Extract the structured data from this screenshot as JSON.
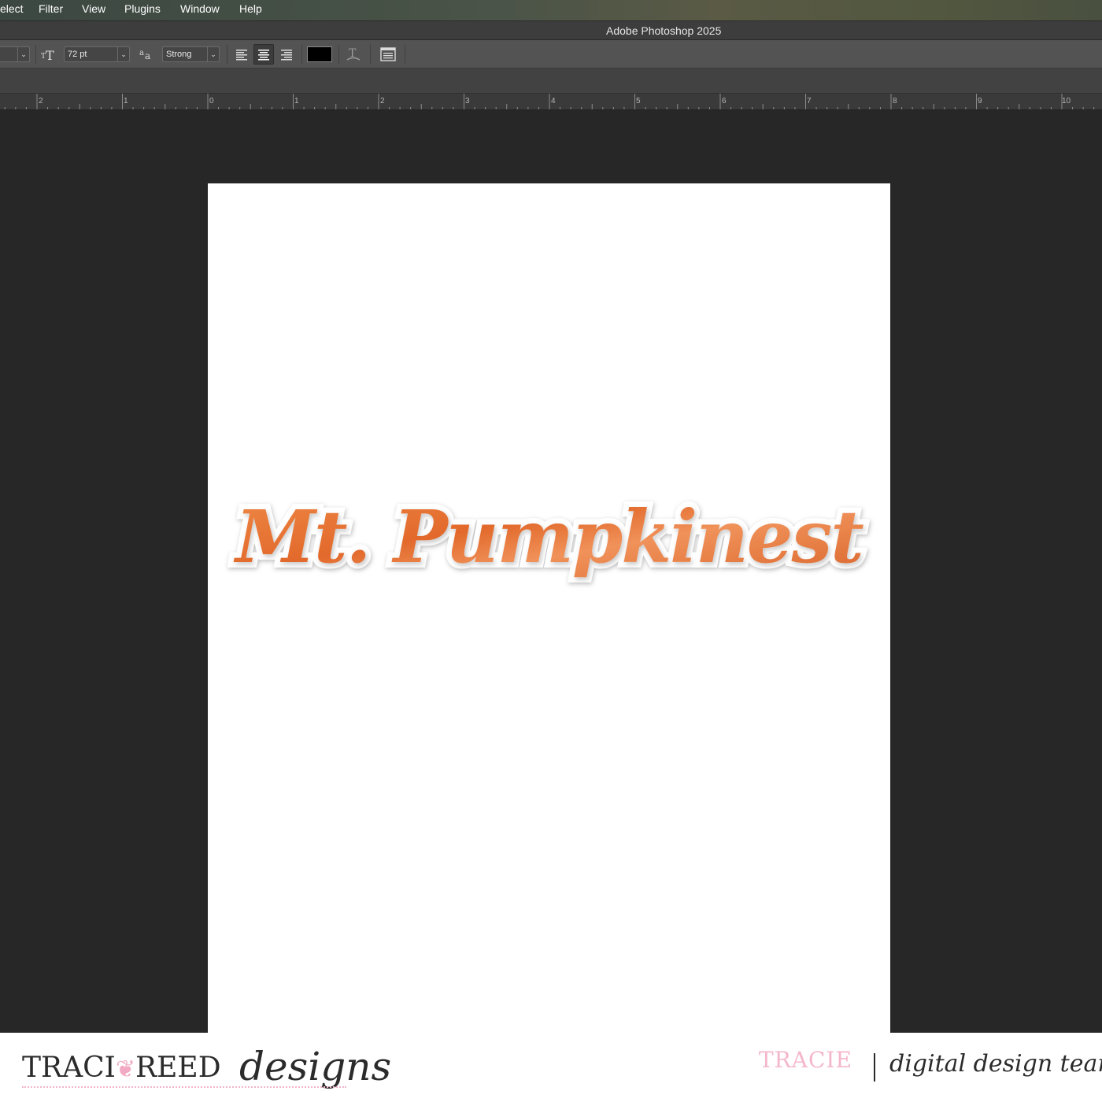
{
  "menu": {
    "items": [
      "elect",
      "Filter",
      "View",
      "Plugins",
      "Window",
      "Help"
    ]
  },
  "titlebar": {
    "title": "Adobe Photoshop 2025"
  },
  "options": {
    "font_size": "72 pt",
    "antialias": "Strong",
    "text_color": "#000000",
    "icons": {
      "font_size": "text-size-icon",
      "antialias": "antialias-icon",
      "align_left": "align-left-icon",
      "align_center": "align-center-icon",
      "align_right": "align-right-icon",
      "warp": "warp-text-icon",
      "panels": "character-paragraph-panel-icon"
    },
    "active_alignment": "center"
  },
  "ruler": {
    "labels": [
      "2",
      "1",
      "0",
      "1",
      "2",
      "3",
      "4",
      "5",
      "6",
      "7",
      "8",
      "9",
      "10"
    ]
  },
  "canvas": {
    "text": "Mt. Pumpkinest",
    "text_color": "#e57a3a",
    "background": "#ffffff"
  },
  "footer": {
    "brand_left": "TRACI",
    "brand_mid": "REED",
    "brand_script": "designs",
    "name": "TRACIE",
    "tagline": "digital design team",
    "accent_color": "#f4b6cc"
  }
}
